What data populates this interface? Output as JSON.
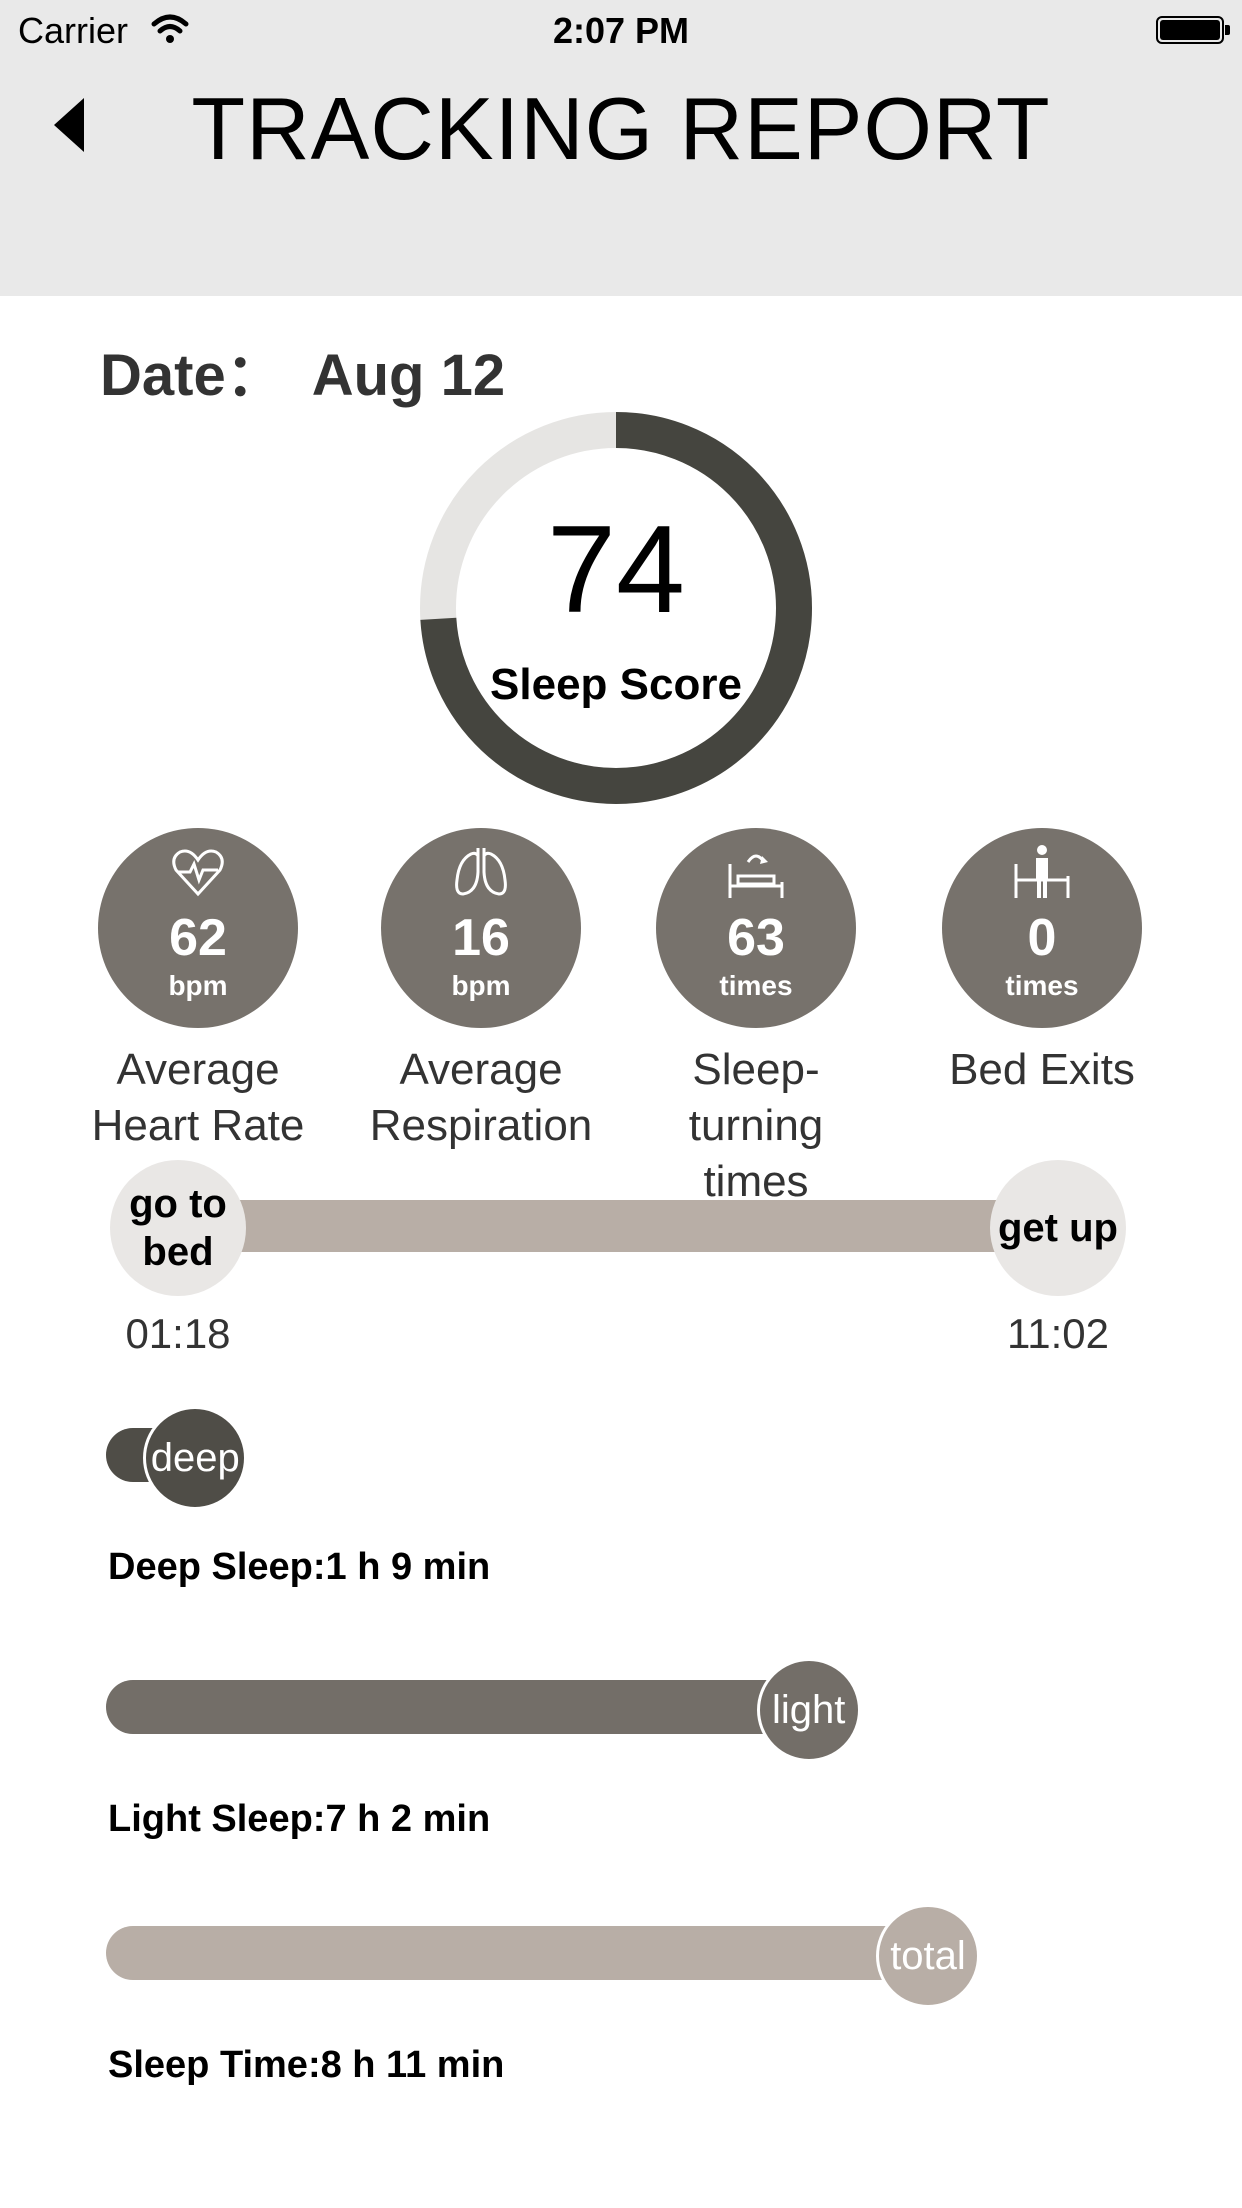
{
  "status_bar": {
    "carrier": "Carrier",
    "time": "2:07 PM"
  },
  "header": {
    "title": "TRACKING REPORT"
  },
  "date": {
    "label": "Date：",
    "value": "Aug 12"
  },
  "score": {
    "value": "74",
    "label": "Sleep Score",
    "fraction": 0.74
  },
  "metrics": [
    {
      "value": "62",
      "unit": "bpm",
      "label_line1": "Average",
      "label_line2": "Heart Rate",
      "icon": "heart-rate-icon"
    },
    {
      "value": "16",
      "unit": "bpm",
      "label_line1": "Average",
      "label_line2": "Respiration",
      "icon": "lungs-icon"
    },
    {
      "value": "63",
      "unit": "times",
      "label_line1": "Sleep-turning",
      "label_line2": "times",
      "icon": "bed-turning-icon"
    },
    {
      "value": "0",
      "unit": "times",
      "label_line1": "Bed Exits",
      "label_line2": "",
      "icon": "bed-exit-icon"
    }
  ],
  "timeline": {
    "start_label_line1": "go to",
    "start_label_line2": "bed",
    "end_label": "get up",
    "start_time": "01:18",
    "end_time": "11:02"
  },
  "sleep": {
    "deep": {
      "knob": "deep",
      "text": "Deep Sleep:1 h 9 min",
      "fraction": 0.14
    },
    "light": {
      "knob": "light",
      "text": "Light Sleep:7 h 2 min",
      "fraction": 0.86
    },
    "total": {
      "knob": "total",
      "text": "Sleep Time:8 h 11 min",
      "fraction": 1.0
    }
  },
  "colors": {
    "header_bg": "#e9e9e9",
    "score_ring": "#45453f",
    "score_track": "#e6e5e3",
    "metric_circle": "#77726c",
    "timeline_bar": "#b8aea6",
    "deep": "#4f4d47",
    "light": "#736e68",
    "total": "#b8aea6"
  }
}
